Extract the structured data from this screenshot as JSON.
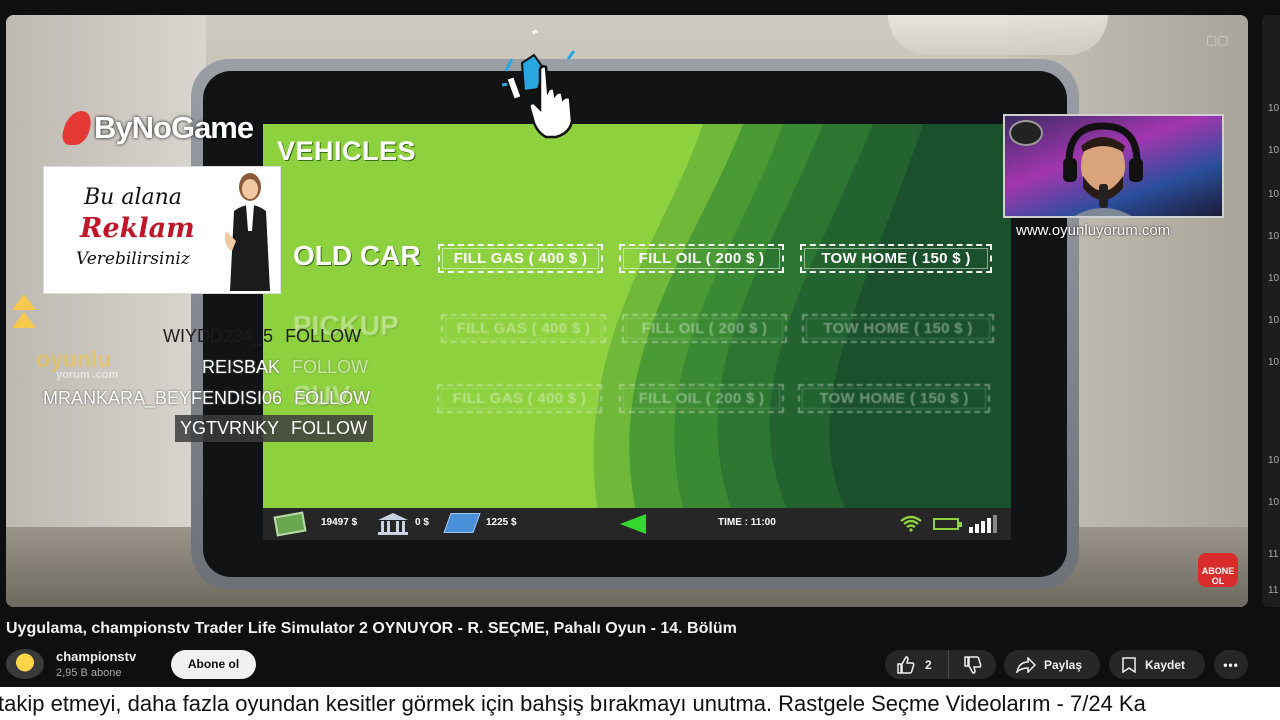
{
  "game": {
    "screen_title": "VEHICLES",
    "vehicles": [
      {
        "name": "OLD CAR",
        "buttons": [
          "FILL GAS ( 400 $ )",
          "FILL OIL ( 200 $ )",
          "TOW HOME ( 150 $ )"
        ]
      },
      {
        "name": "PICKUP",
        "buttons": [
          "FILL GAS ( 400 $ )",
          "FILL OIL ( 200 $ )",
          "TOW HOME ( 150 $ )"
        ]
      },
      {
        "name": "SUV",
        "buttons": [
          "FILL GAS ( 400 $ )",
          "FILL OIL ( 200 $ )",
          "TOW HOME ( 150 $ )"
        ]
      }
    ],
    "status": {
      "cash": "19497 $",
      "bank": "0 $",
      "card": "1225 $",
      "time": "TIME : 11:00"
    },
    "colors": {
      "screen_green": "#8ed13e",
      "dark_green": "#1f5a2e",
      "status_bar": "#262626"
    }
  },
  "overlay": {
    "brand": "ByNoGame",
    "ad": {
      "line1": "Bu alana",
      "line2": "Reklam",
      "line3": "Verebilirsiniz"
    },
    "follows": [
      {
        "name": "WIYDD234_5",
        "action": "FOLLOW"
      },
      {
        "name": "REISBAK",
        "action": "FOLLOW"
      },
      {
        "name": "MRANKARA_BEYFENDISI06",
        "action": "FOLLOW"
      },
      {
        "name": "YGTVRNKY",
        "action": "FOLLOW"
      }
    ],
    "watermark": "oyunlu",
    "watermark_sub": "yorum .com",
    "webcam_url": "www.oyunluyorum.com",
    "subscribe_badge_l1": "ABONE",
    "subscribe_badge_l2": "OL"
  },
  "youtube": {
    "title": "Uygulama, championstv Trader Life Simulator 2 OYNUYOR - R. SEÇME, Pahalı Oyun - 14. Bölüm",
    "channel": {
      "name": "championstv",
      "subs": "2,95 B abone"
    },
    "subscribe_label": "Abone ol",
    "likes": "2",
    "share_label": "Paylaş",
    "save_label": "Kaydet",
    "more_label": "•••",
    "sidebar_ticks": [
      "10",
      "10",
      "10",
      "10",
      "10",
      "10",
      "10",
      "10",
      "10",
      "11",
      "11"
    ]
  },
  "ticker": {
    "text": "takip etmeyi, daha fazla oyundan kesitler görmek için bahşiş bırakmayı unutma. Rastgele Seçme Videolarım - 7/24 Ka"
  }
}
